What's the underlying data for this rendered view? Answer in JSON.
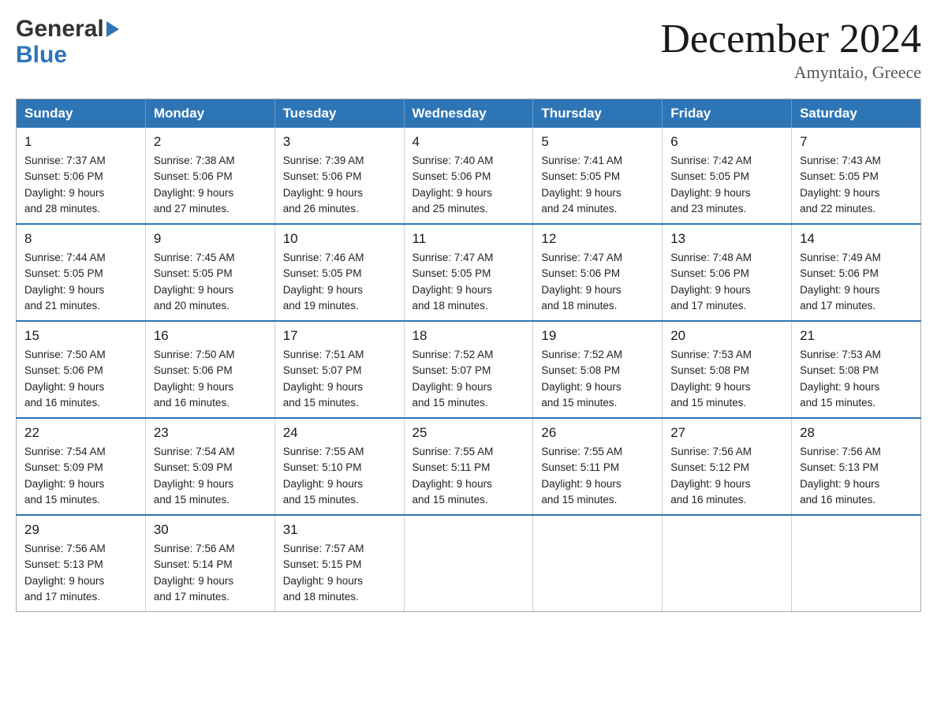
{
  "header": {
    "logo_line1": "General",
    "logo_line2": "Blue",
    "month_title": "December 2024",
    "location": "Amyntaio, Greece"
  },
  "calendar": {
    "headers": [
      "Sunday",
      "Monday",
      "Tuesday",
      "Wednesday",
      "Thursday",
      "Friday",
      "Saturday"
    ],
    "weeks": [
      [
        {
          "day": "1",
          "sunrise": "7:37 AM",
          "sunset": "5:06 PM",
          "daylight": "9 hours and 28 minutes."
        },
        {
          "day": "2",
          "sunrise": "7:38 AM",
          "sunset": "5:06 PM",
          "daylight": "9 hours and 27 minutes."
        },
        {
          "day": "3",
          "sunrise": "7:39 AM",
          "sunset": "5:06 PM",
          "daylight": "9 hours and 26 minutes."
        },
        {
          "day": "4",
          "sunrise": "7:40 AM",
          "sunset": "5:06 PM",
          "daylight": "9 hours and 25 minutes."
        },
        {
          "day": "5",
          "sunrise": "7:41 AM",
          "sunset": "5:05 PM",
          "daylight": "9 hours and 24 minutes."
        },
        {
          "day": "6",
          "sunrise": "7:42 AM",
          "sunset": "5:05 PM",
          "daylight": "9 hours and 23 minutes."
        },
        {
          "day": "7",
          "sunrise": "7:43 AM",
          "sunset": "5:05 PM",
          "daylight": "9 hours and 22 minutes."
        }
      ],
      [
        {
          "day": "8",
          "sunrise": "7:44 AM",
          "sunset": "5:05 PM",
          "daylight": "9 hours and 21 minutes."
        },
        {
          "day": "9",
          "sunrise": "7:45 AM",
          "sunset": "5:05 PM",
          "daylight": "9 hours and 20 minutes."
        },
        {
          "day": "10",
          "sunrise": "7:46 AM",
          "sunset": "5:05 PM",
          "daylight": "9 hours and 19 minutes."
        },
        {
          "day": "11",
          "sunrise": "7:47 AM",
          "sunset": "5:05 PM",
          "daylight": "9 hours and 18 minutes."
        },
        {
          "day": "12",
          "sunrise": "7:47 AM",
          "sunset": "5:06 PM",
          "daylight": "9 hours and 18 minutes."
        },
        {
          "day": "13",
          "sunrise": "7:48 AM",
          "sunset": "5:06 PM",
          "daylight": "9 hours and 17 minutes."
        },
        {
          "day": "14",
          "sunrise": "7:49 AM",
          "sunset": "5:06 PM",
          "daylight": "9 hours and 17 minutes."
        }
      ],
      [
        {
          "day": "15",
          "sunrise": "7:50 AM",
          "sunset": "5:06 PM",
          "daylight": "9 hours and 16 minutes."
        },
        {
          "day": "16",
          "sunrise": "7:50 AM",
          "sunset": "5:06 PM",
          "daylight": "9 hours and 16 minutes."
        },
        {
          "day": "17",
          "sunrise": "7:51 AM",
          "sunset": "5:07 PM",
          "daylight": "9 hours and 15 minutes."
        },
        {
          "day": "18",
          "sunrise": "7:52 AM",
          "sunset": "5:07 PM",
          "daylight": "9 hours and 15 minutes."
        },
        {
          "day": "19",
          "sunrise": "7:52 AM",
          "sunset": "5:08 PM",
          "daylight": "9 hours and 15 minutes."
        },
        {
          "day": "20",
          "sunrise": "7:53 AM",
          "sunset": "5:08 PM",
          "daylight": "9 hours and 15 minutes."
        },
        {
          "day": "21",
          "sunrise": "7:53 AM",
          "sunset": "5:08 PM",
          "daylight": "9 hours and 15 minutes."
        }
      ],
      [
        {
          "day": "22",
          "sunrise": "7:54 AM",
          "sunset": "5:09 PM",
          "daylight": "9 hours and 15 minutes."
        },
        {
          "day": "23",
          "sunrise": "7:54 AM",
          "sunset": "5:09 PM",
          "daylight": "9 hours and 15 minutes."
        },
        {
          "day": "24",
          "sunrise": "7:55 AM",
          "sunset": "5:10 PM",
          "daylight": "9 hours and 15 minutes."
        },
        {
          "day": "25",
          "sunrise": "7:55 AM",
          "sunset": "5:11 PM",
          "daylight": "9 hours and 15 minutes."
        },
        {
          "day": "26",
          "sunrise": "7:55 AM",
          "sunset": "5:11 PM",
          "daylight": "9 hours and 15 minutes."
        },
        {
          "day": "27",
          "sunrise": "7:56 AM",
          "sunset": "5:12 PM",
          "daylight": "9 hours and 16 minutes."
        },
        {
          "day": "28",
          "sunrise": "7:56 AM",
          "sunset": "5:13 PM",
          "daylight": "9 hours and 16 minutes."
        }
      ],
      [
        {
          "day": "29",
          "sunrise": "7:56 AM",
          "sunset": "5:13 PM",
          "daylight": "9 hours and 17 minutes."
        },
        {
          "day": "30",
          "sunrise": "7:56 AM",
          "sunset": "5:14 PM",
          "daylight": "9 hours and 17 minutes."
        },
        {
          "day": "31",
          "sunrise": "7:57 AM",
          "sunset": "5:15 PM",
          "daylight": "9 hours and 18 minutes."
        },
        null,
        null,
        null,
        null
      ]
    ],
    "labels": {
      "sunrise": "Sunrise:",
      "sunset": "Sunset:",
      "daylight": "Daylight:"
    }
  }
}
